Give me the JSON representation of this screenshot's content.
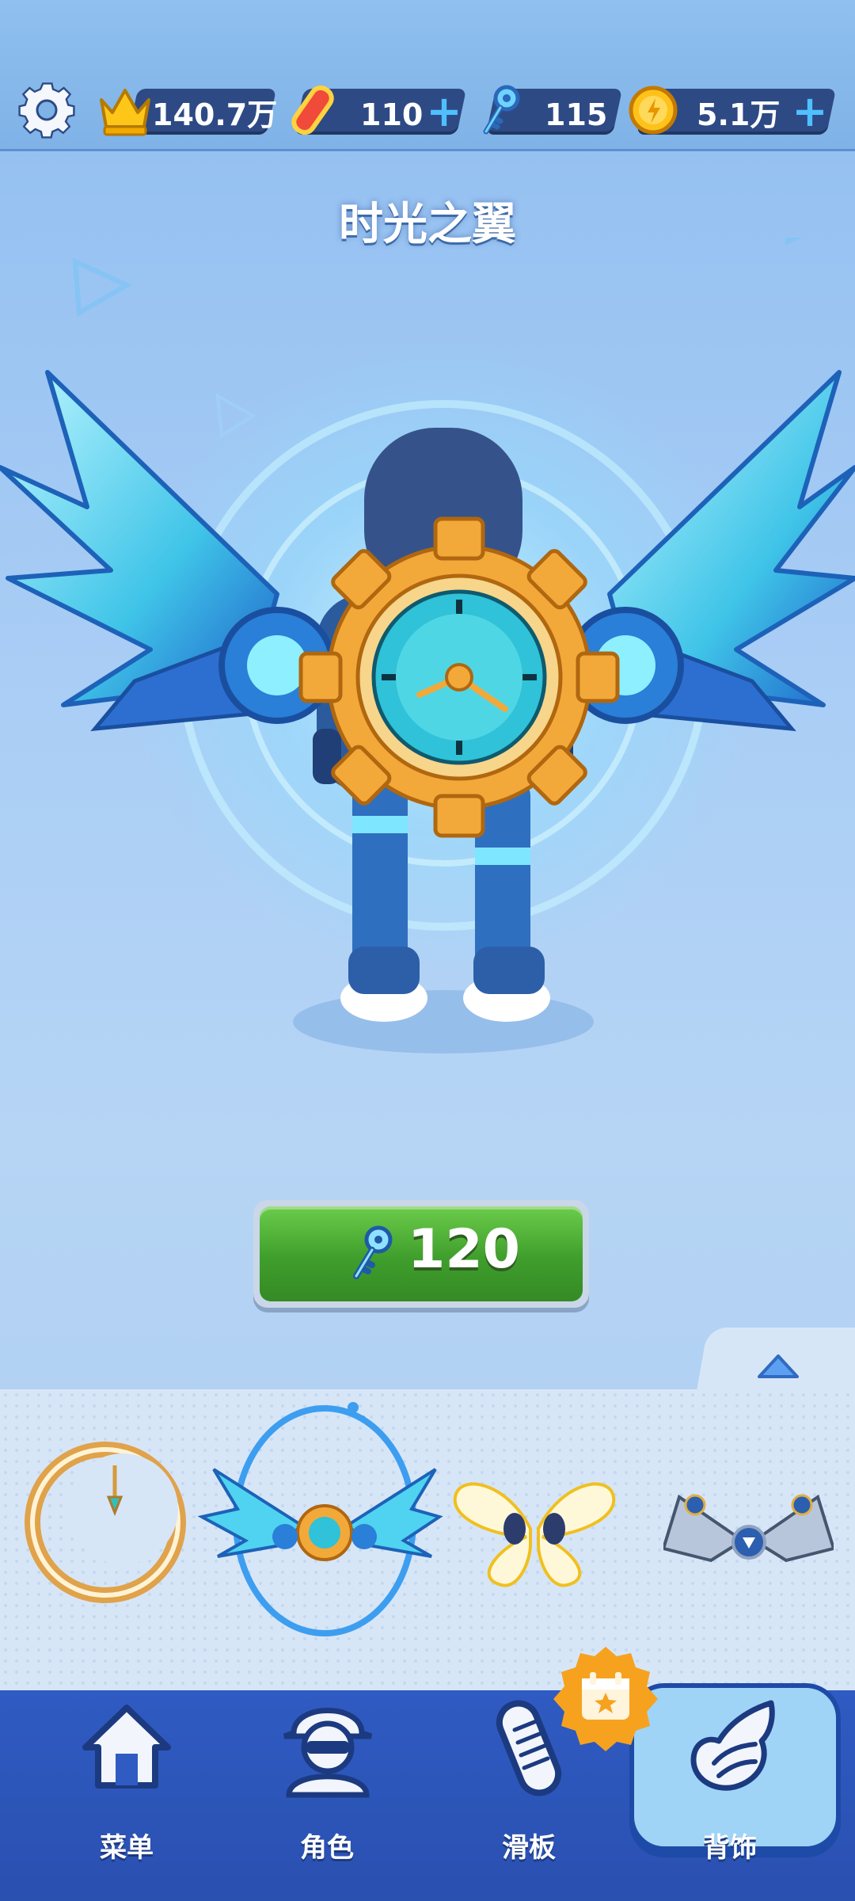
{
  "currencies": {
    "crowns": "140.7万",
    "boards": "110",
    "keys": "115",
    "coins": "5.1万"
  },
  "item": {
    "name": "时光之翼",
    "price": "120"
  },
  "tray": {
    "items": [
      "moon-ring-accessory",
      "clock-wings-accessory",
      "butterfly-wings-accessory",
      "mech-wings-accessory"
    ],
    "selected_index": 1
  },
  "nav": {
    "menu": "菜单",
    "character": "角色",
    "board": "滑板",
    "accessory": "背饰",
    "active": "背饰"
  },
  "colors": {
    "buy_button": "#3f9e2c",
    "nav_bar": "#2f5bc2",
    "active_tab": "#9fd4f7",
    "badge": "#f6a21f"
  }
}
